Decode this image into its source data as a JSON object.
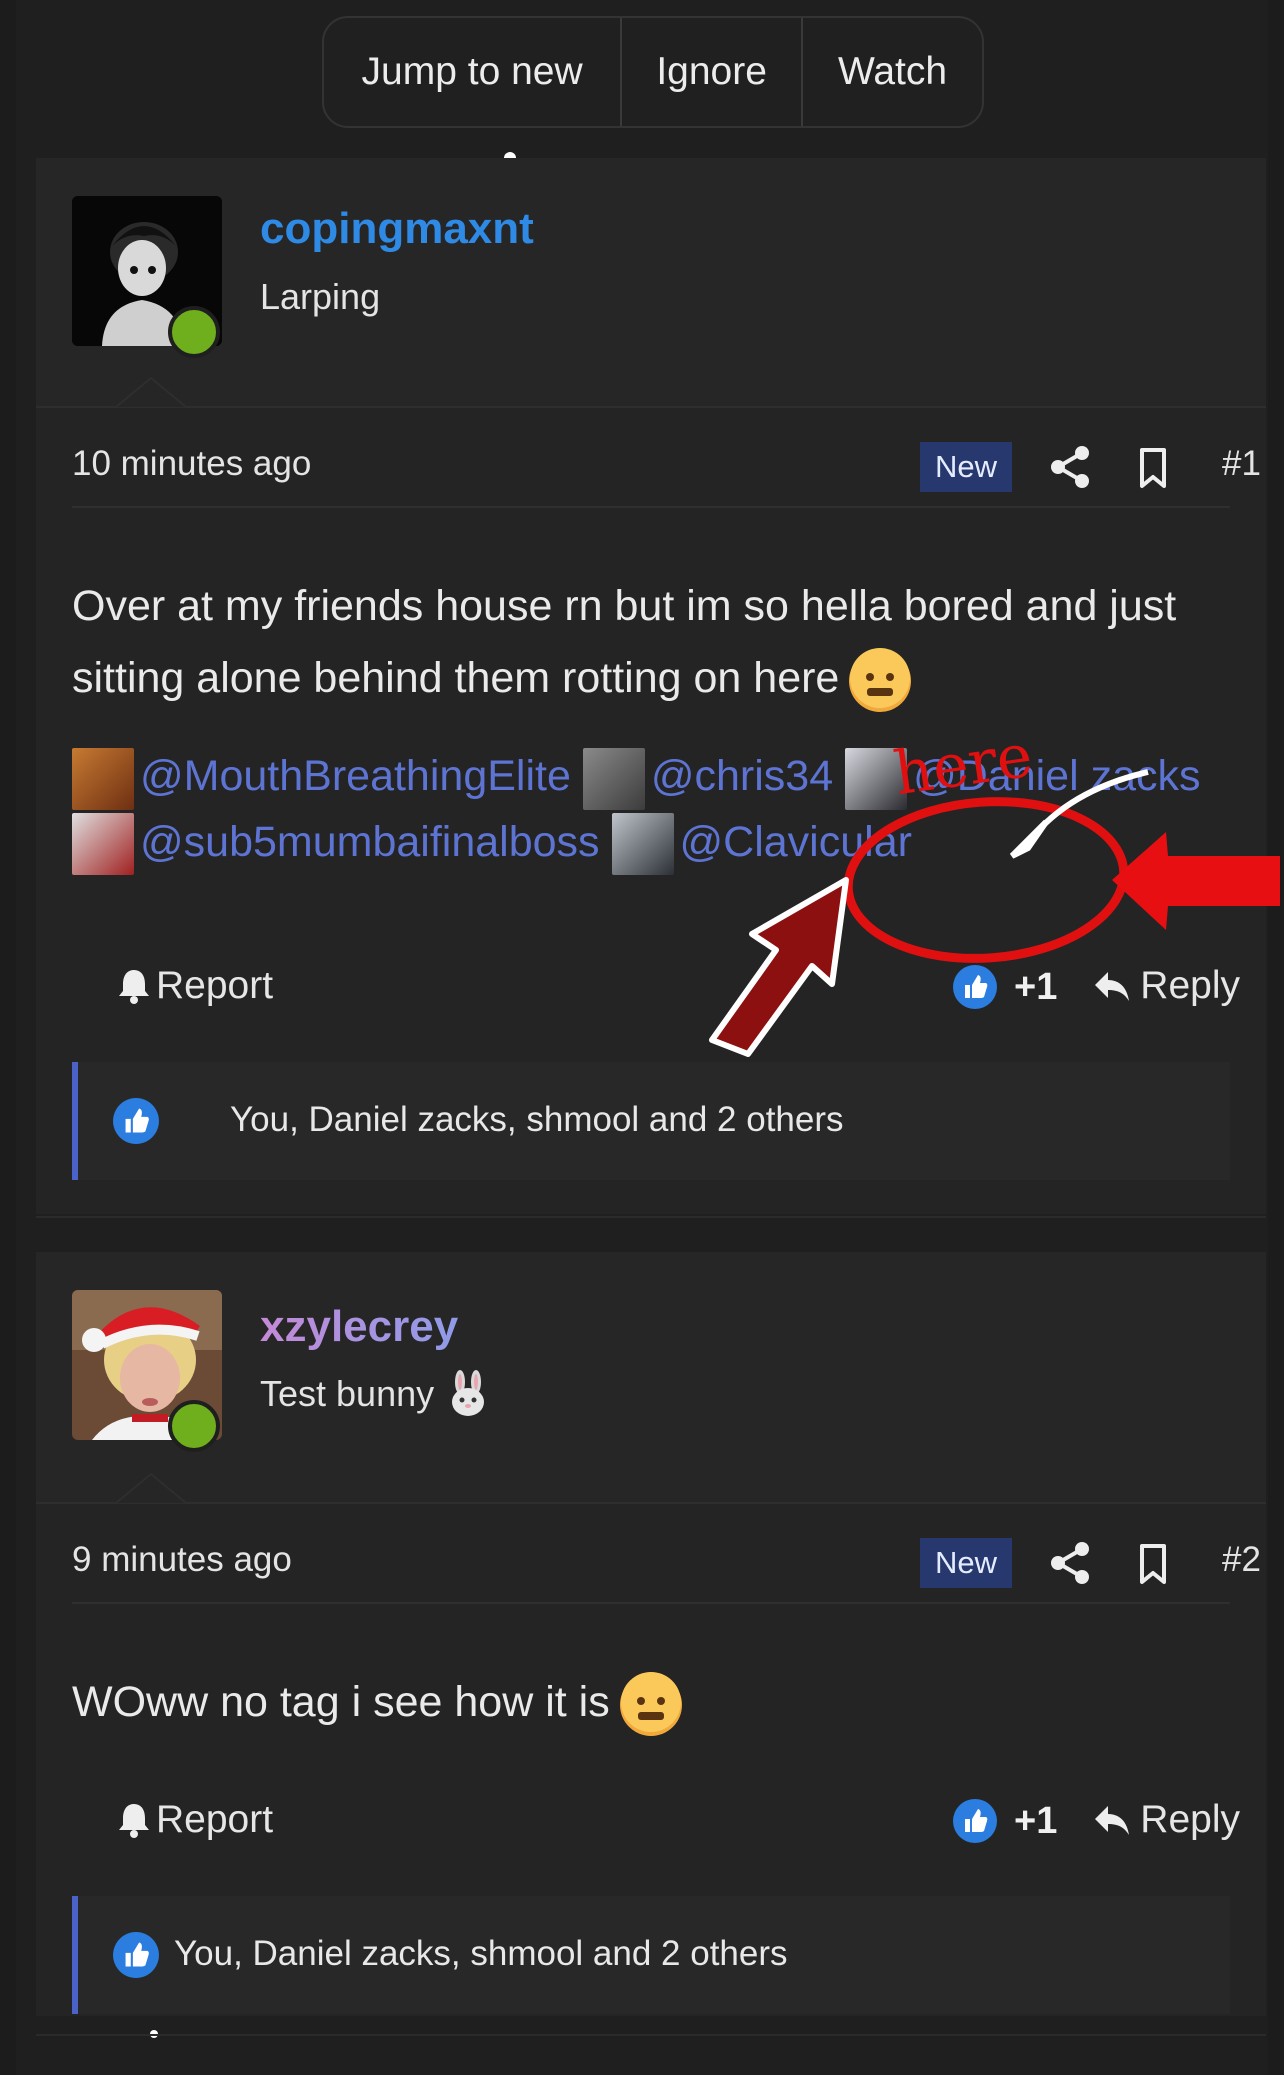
{
  "toolbar": {
    "jump_label": "Jump to new",
    "ignore_label": "Ignore",
    "watch_label": "Watch"
  },
  "posts": [
    {
      "username": "copingmaxnt",
      "username_color": "#2f8ae6",
      "user_title": "Larping",
      "time": "10 minutes ago",
      "badge": "New",
      "number": "#1",
      "text": "Over at my friends house rn but im so hella bored and just sitting alone behind them rotting on here",
      "mentions": [
        "@MouthBreathingElite",
        "@chris34",
        "@Daniel zacks",
        "@sub5mumbaifinalboss",
        "@Clavicular"
      ],
      "report_label": "Report",
      "like_count": "+1",
      "reply_label": "Reply",
      "likes_summary": "You, Daniel zacks, shmool and 2 others"
    },
    {
      "username": "xzylecrey",
      "username_color": "#b48be0",
      "user_title": "Test bunny",
      "time": "9 minutes ago",
      "badge": "New",
      "number": "#2",
      "text": "WOww no tag i see how it is",
      "report_label": "Report",
      "like_count": "+1",
      "reply_label": "Reply",
      "likes_summary": "You, Daniel zacks, shmool and 2 others"
    }
  ],
  "annotation": {
    "label": "here",
    "color": "#e01010"
  },
  "colors": {
    "accent": "#2f8ae6",
    "mention": "#5d74d3",
    "badge": "#26386e",
    "online": "#6fae1c"
  }
}
